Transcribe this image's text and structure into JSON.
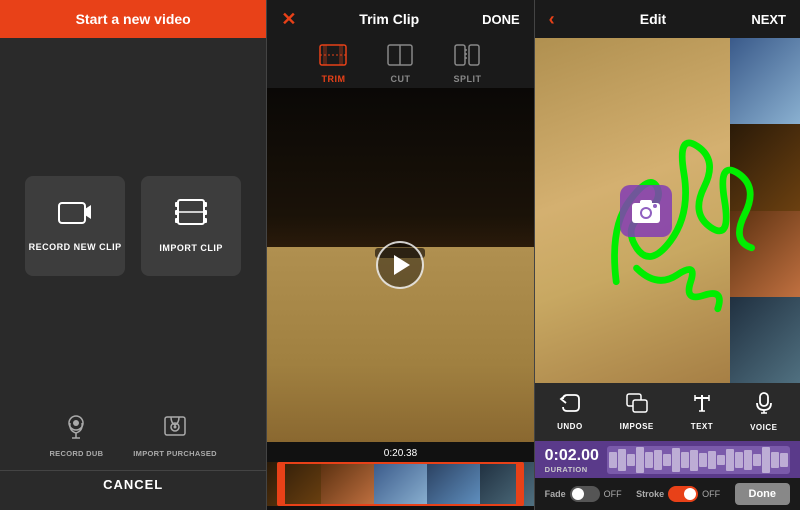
{
  "panel1": {
    "header": {
      "title": "Start a new video"
    },
    "actions": [
      {
        "id": "record",
        "label": "RECORD NEW CLIP",
        "icon": "🎥"
      },
      {
        "id": "import",
        "label": "IMPORT CLIP",
        "icon": "🎞"
      }
    ],
    "bottom_actions": [
      {
        "id": "dub",
        "label": "RECORD DUB",
        "icon": "😊"
      },
      {
        "id": "import_purchased",
        "label": "IMPORT PURCHASED",
        "icon": "🎵"
      }
    ],
    "cancel_label": "CANCEL"
  },
  "panel2": {
    "header": {
      "title": "Trim Clip",
      "done_label": "DONE"
    },
    "tabs": [
      {
        "id": "trim",
        "label": "TRIM",
        "active": true
      },
      {
        "id": "cut",
        "label": "CUT",
        "active": false
      },
      {
        "id": "split",
        "label": "SPLIT",
        "active": false
      }
    ],
    "timestamp": "0:20.38"
  },
  "panel3": {
    "header": {
      "title": "Edit",
      "next_label": "NEXT"
    },
    "tools": [
      {
        "id": "undo",
        "label": "UNDO",
        "icon": "↩"
      },
      {
        "id": "impose",
        "label": "IMPOSE",
        "icon": "⊞"
      },
      {
        "id": "text",
        "label": "TEXT",
        "icon": "✏"
      },
      {
        "id": "voice",
        "label": "VOICE",
        "icon": "🎤"
      }
    ],
    "duration": {
      "time": "0:02.00",
      "label": "DURATION"
    },
    "controls": {
      "fade_label": "Fade",
      "fade_on": false,
      "off_label": "OFF",
      "stroke_label": "Stroke",
      "stroke_on": true,
      "done_label": "Done"
    }
  },
  "colors": {
    "accent": "#e84118",
    "purple": "#5a3a8a"
  }
}
